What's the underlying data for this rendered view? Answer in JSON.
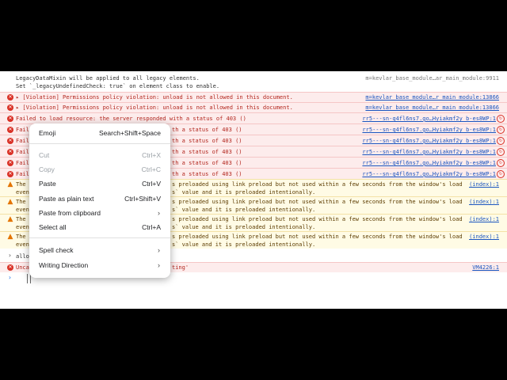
{
  "console": {
    "line1": "LegacyDataMixin will be applied to all legacy elements.",
    "line2": "Set `_legacyUndefinedCheck: true` on element class to enable.",
    "line1_src": "m=kevlar_base_module…ar_main_module:9911",
    "violation1": "▸ [Violation] Permissions policy violation: unload is not allowed in this document.",
    "violation1_src": "m=kevlar_base_module…r_main_module:13866",
    "violation2": "▸ [Violation] Permissions policy violation: unload is not allowed in this document.",
    "violation2_src": "m=kevlar_base_module…r_main_module:13866",
    "fail_full": "Failed to load resource: the server responded with a status of 403 ()",
    "fail_prefix": "Faile",
    "fail_tail": "th a status of 403 ()",
    "fail_src": "rr5---sn-q4fl6ns7.go…Hyiakmf2y_b-es8WP:1",
    "warn_prefix": "The",
    "warn_line1": "s preloaded using link preload but not used within a few seconds from the window's load",
    "warn_prefix2": "even",
    "warn_line2": "s` value and it is preloaded intentionally.",
    "warn_src": "(index):1",
    "prompt_text": "allo",
    "uncaught_prefix": "Unca",
    "uncaught_tail": "ting'",
    "uncaught_src": "VM4226:1"
  },
  "context_menu": {
    "emoji": "Emoji",
    "emoji_sc": "Search+Shift+Space",
    "cut": "Cut",
    "cut_sc": "Ctrl+X",
    "copy": "Copy",
    "copy_sc": "Ctrl+C",
    "paste": "Paste",
    "paste_sc": "Ctrl+V",
    "paste_plain": "Paste as plain text",
    "paste_plain_sc": "Ctrl+Shift+V",
    "paste_clip": "Paste from clipboard",
    "select_all": "Select all",
    "select_all_sc": "Ctrl+A",
    "spell_check": "Spell check",
    "writing_direction": "Writing Direction"
  }
}
